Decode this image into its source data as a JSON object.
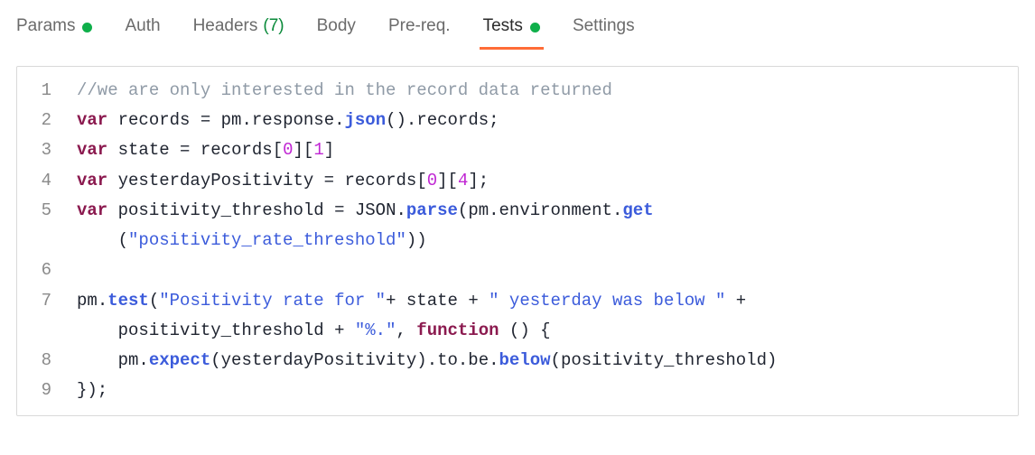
{
  "tabs": {
    "params": {
      "label": "Params",
      "has_dot": true
    },
    "auth": {
      "label": "Auth"
    },
    "headers": {
      "label": "Headers",
      "count": "(7)"
    },
    "body": {
      "label": "Body"
    },
    "prereq": {
      "label": "Pre-req."
    },
    "tests": {
      "label": "Tests",
      "has_dot": true,
      "active": true
    },
    "settings": {
      "label": "Settings"
    }
  },
  "code": {
    "line1_comment": "//we are only interested in the record data returned",
    "line2": {
      "kw": "var",
      "name": " records ",
      "eq": "= ",
      "pm": "pm",
      "dot1": ".",
      "response": "response",
      "dot2": ".",
      "json": "json",
      "call": "()",
      "dot3": ".",
      "records": "records",
      "semi": ";"
    },
    "line3": {
      "kw": "var",
      "name": " state ",
      "eq": "= ",
      "records": "records",
      "lb1": "[",
      "n0": "0",
      "rb1": "][",
      "n1": "1",
      "rb2": "]"
    },
    "line4": {
      "kw": "var",
      "name": " yesterdayPositivity ",
      "eq": "= ",
      "records": "records",
      "lb1": "[",
      "n0": "0",
      "rb1": "][",
      "n4": "4",
      "rb2": "];"
    },
    "line5": {
      "kw": "var",
      "name": " positivity_threshold ",
      "eq": "= ",
      "json": "JSON",
      "dot1": ".",
      "parse": "parse",
      "lp": "(",
      "pm": "pm",
      "dot2": ".",
      "env": "environment",
      "dot3": ".",
      "get": "get"
    },
    "line5b": {
      "indent": "    ",
      "lp": "(",
      "str": "\"positivity_rate_threshold\"",
      "rp": "))"
    },
    "line7": {
      "pm": "pm",
      "dot": ".",
      "test": "test",
      "lp": "(",
      "s1": "\"Positivity rate for \"",
      "plus1": "+ ",
      "state": "state ",
      "plus2": "+ ",
      "s2": "\" yesterday was below \"",
      "plus3": " +"
    },
    "line7b": {
      "indent": "    ",
      "pt": "positivity_threshold ",
      "plus": "+ ",
      "s3": "\"%.\"",
      "comma": ", ",
      "fn": "function",
      "rest": " () {"
    },
    "line8": {
      "indent": "    ",
      "pm": "pm",
      "dot1": ".",
      "expect": "expect",
      "lp": "(",
      "yp": "yesterdayPositivity",
      "rp": ")",
      "chain": ".to.be.",
      "below": "below",
      "lp2": "(",
      "pt": "positivity_threshold",
      "rp2": ")"
    },
    "line9": "});",
    "ln": {
      "1": "1",
      "2": "2",
      "3": "3",
      "4": "4",
      "5": "5",
      "6": "6",
      "7": "7",
      "8": "8",
      "9": "9",
      "blank": ""
    }
  }
}
